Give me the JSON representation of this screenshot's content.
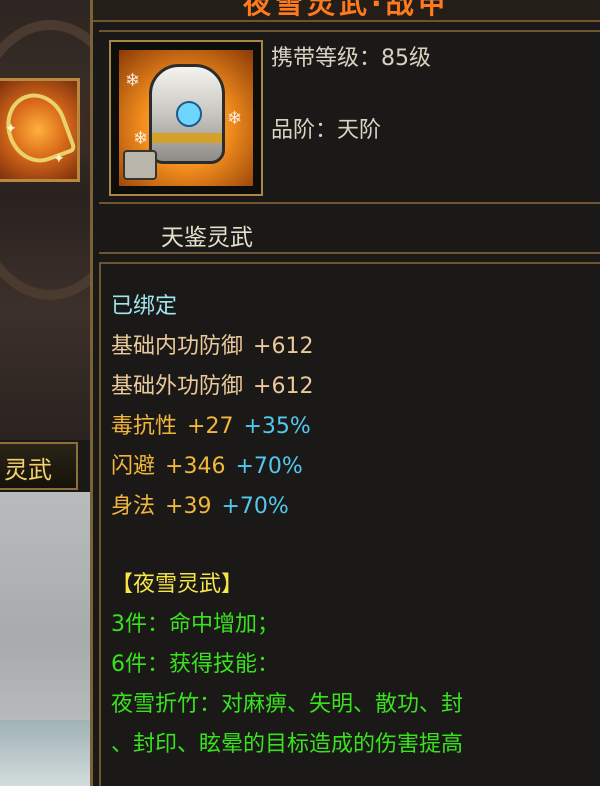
{
  "tooltip": {
    "title_partial": "夜雪灵武·战甲",
    "required_level": "携带等级：85级",
    "grade": "品阶：天阶",
    "item_name": "天鉴灵武",
    "bound_status": "已绑定",
    "base_stats": [
      {
        "label": "基础内功防御",
        "value": "+612"
      },
      {
        "label": "基础外功防御",
        "value": "+612"
      }
    ],
    "attributes": [
      {
        "label": "毒抗性",
        "value": "+27",
        "bonus": "+35%"
      },
      {
        "label": "闪避",
        "value": "+346",
        "bonus": "+70%"
      },
      {
        "label": "身法",
        "value": "+39",
        "bonus": "+70%"
      }
    ],
    "set": {
      "name": "【夜雪灵武】",
      "bonus_3": "3件：命中增加；",
      "bonus_6": "6件：获得技能：",
      "skill_line_1": "夜雪折竹：对麻痹、失明、散功、封",
      "skill_line_2": "、封印、眩晕的目标造成的伤害提高"
    }
  },
  "side_panel": {
    "name_tab": "灵武"
  },
  "colors": {
    "border": "#6e5530",
    "set_green": "#39e21e",
    "gold": "#f2b63b",
    "cyan": "#51c9ee",
    "title_orange": "#ff7a1f"
  },
  "icons": [
    "armor-item-icon",
    "weapon-item-icon"
  ]
}
